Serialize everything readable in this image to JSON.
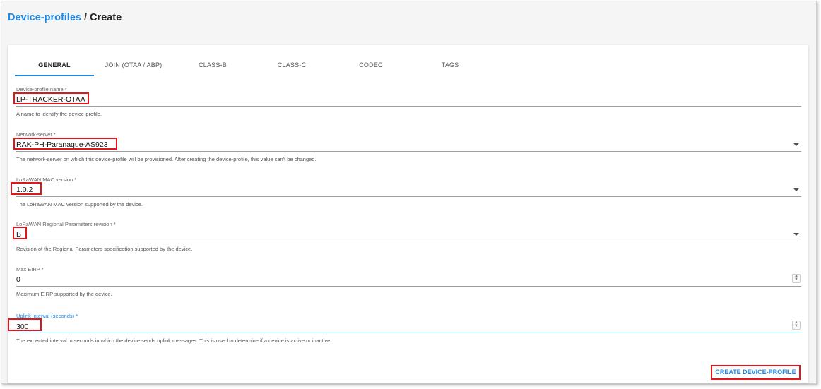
{
  "breadcrumb": {
    "parent": "Device-profiles",
    "separator": "/",
    "current": "Create"
  },
  "tabs": [
    {
      "label": "GENERAL",
      "active": true
    },
    {
      "label": "JOIN (OTAA / ABP)",
      "active": false
    },
    {
      "label": "CLASS-B",
      "active": false
    },
    {
      "label": "CLASS-C",
      "active": false
    },
    {
      "label": "CODEC",
      "active": false
    },
    {
      "label": "TAGS",
      "active": false
    }
  ],
  "form": {
    "name": {
      "label": "Device-profile name *",
      "value": "LP-TRACKER-OTAA",
      "helper": "A name to identify the device-profile."
    },
    "network_server": {
      "label": "Network-server *",
      "value": "RAK-PH-Paranaque-AS923",
      "helper": "The network-server on which this device-profile will be provisioned. After creating the device-profile, this value can't be changed."
    },
    "mac_version": {
      "label": "LoRaWAN MAC version *",
      "value": "1.0.2",
      "helper": "The LoRaWAN MAC version supported by the device."
    },
    "regional_params": {
      "label": "LoRaWAN Regional Parameters revision *",
      "value": "B",
      "helper": "Revision of the Regional Parameters specification supported by the device."
    },
    "max_eirp": {
      "label": "Max EIRP *",
      "value": "0",
      "helper": "Maximum EIRP supported by the device."
    },
    "uplink_interval": {
      "label": "Uplink interval (seconds) *",
      "value": "300",
      "helper": "The expected interval in seconds in which the device sends uplink messages. This is used to determine if a device is active or inactive."
    }
  },
  "actions": {
    "create_label": "CREATE DEVICE-PROFILE"
  },
  "colors": {
    "accent": "#1e88e5",
    "highlight": "#e0161c"
  },
  "icons": {
    "dropdown": "caret-down-icon",
    "spinner": "number-spinner-icon"
  }
}
